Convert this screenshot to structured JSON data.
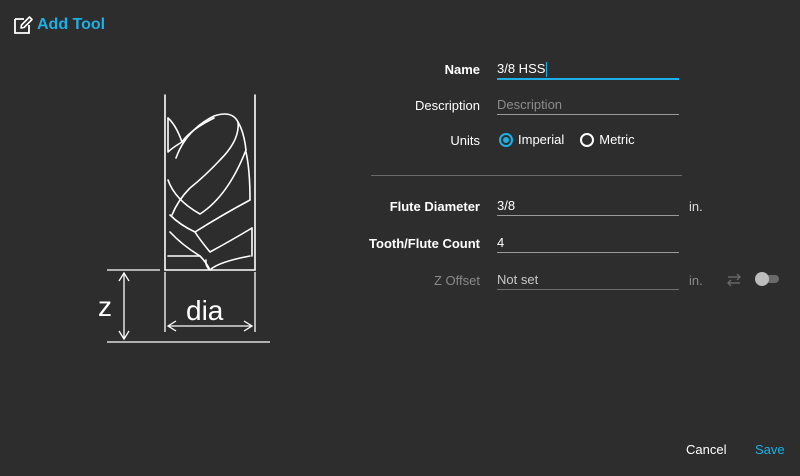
{
  "dialog": {
    "title": "Add Tool",
    "title_icon": "edit-icon"
  },
  "illustration": {
    "z_label": "z",
    "dia_label": "dia"
  },
  "form": {
    "name": {
      "label": "Name",
      "value": "3/8 HSS"
    },
    "description": {
      "label": "Description",
      "placeholder": "Description"
    },
    "units": {
      "label": "Units",
      "options": [
        "Imperial",
        "Metric"
      ],
      "selected": "Imperial"
    },
    "flute_diameter": {
      "label": "Flute Diameter",
      "value": "3/8",
      "unit": "in."
    },
    "tooth_count": {
      "label": "Tooth/Flute Count",
      "value": "4"
    },
    "z_offset": {
      "label": "Z Offset",
      "value": "Not set",
      "unit": "in.",
      "sync_icon": "swap-arrows-icon",
      "enabled": false
    }
  },
  "actions": {
    "cancel": "Cancel",
    "save": "Save"
  },
  "colors": {
    "accent": "#1cb0e6",
    "background": "#2d2d2d",
    "text": "#ffffff",
    "disabled": "#8a8a8a"
  }
}
